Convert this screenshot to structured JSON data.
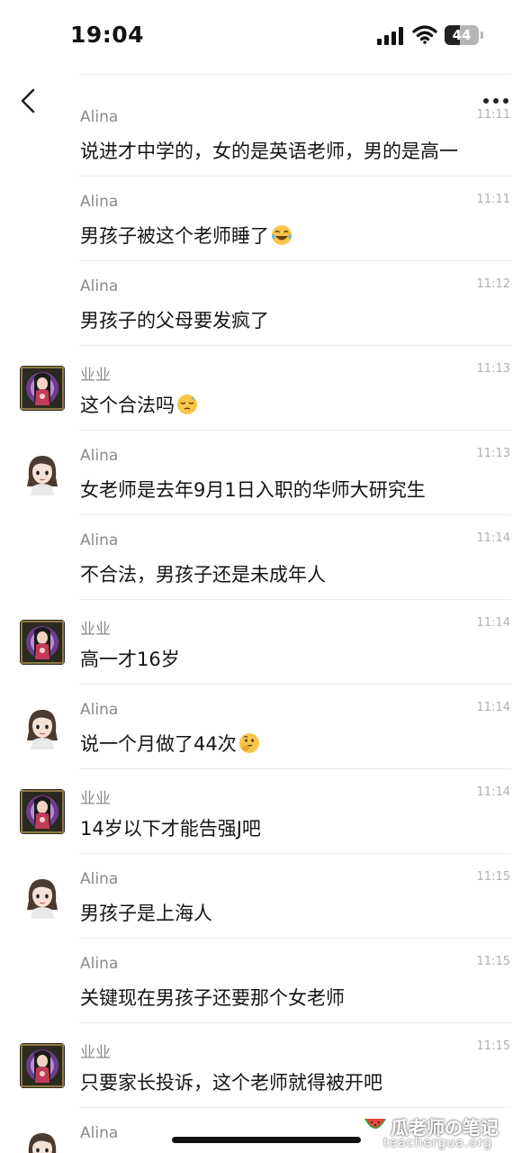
{
  "status_bar": {
    "time": "19:04",
    "battery_level": "44",
    "battery_fraction": 0.44
  },
  "nav": {
    "back_icon": "chevron-left-icon",
    "more_icon": "ellipsis-icon"
  },
  "messages": [
    {
      "sender": "Alina",
      "time": "11:11",
      "text": "说进才中学的，女的是英语老师，男的是高一",
      "avatar": "none",
      "emoji": ""
    },
    {
      "sender": "Alina",
      "time": "11:11",
      "text": "男孩子被这个老师睡了",
      "avatar": "none",
      "emoji": "laughing-crying-emoji"
    },
    {
      "sender": "Alina",
      "time": "11:12",
      "text": "男孩子的父母要发疯了",
      "avatar": "none",
      "emoji": ""
    },
    {
      "sender": "业业",
      "time": "11:13",
      "text": "这个合法吗",
      "avatar": "anime-avatar",
      "emoji": "sleepy-face-emoji"
    },
    {
      "sender": "Alina",
      "time": "11:13",
      "text": "女老师是去年9月1日入职的华师大研究生",
      "avatar": "cartoon-girl-avatar",
      "emoji": ""
    },
    {
      "sender": "Alina",
      "time": "11:14",
      "text": "不合法，男孩子还是未成年人",
      "avatar": "none",
      "emoji": ""
    },
    {
      "sender": "业业",
      "time": "11:14",
      "text": "高一才16岁",
      "avatar": "anime-avatar",
      "emoji": ""
    },
    {
      "sender": "Alina",
      "time": "11:14",
      "text": "说一个月做了44次",
      "avatar": "cartoon-girl-avatar",
      "emoji": "thinking-face-emoji"
    },
    {
      "sender": "业业",
      "time": "11:14",
      "text": "14岁以下才能告强J吧",
      "avatar": "anime-avatar",
      "emoji": ""
    },
    {
      "sender": "Alina",
      "time": "11:15",
      "text": "男孩子是上海人",
      "avatar": "cartoon-girl-avatar",
      "emoji": ""
    },
    {
      "sender": "Alina",
      "time": "11:15",
      "text": "关键现在男孩子还要那个女老师",
      "avatar": "none",
      "emoji": ""
    },
    {
      "sender": "业业",
      "time": "11:15",
      "text": "只要家长投诉，这个老师就得被开吧",
      "avatar": "anime-avatar",
      "emoji": ""
    },
    {
      "sender": "Alina",
      "time": "",
      "text": "",
      "avatar": "cartoon-girl-avatar",
      "emoji": ""
    }
  ],
  "watermark": {
    "title": "瓜老师の笔记",
    "url": "teachergua.org",
    "icon": "watermelon-icon"
  },
  "colors": {
    "sender": "#8a8a8a",
    "time": "#b0b0b0",
    "text": "#151515",
    "divider": "#ececec"
  }
}
